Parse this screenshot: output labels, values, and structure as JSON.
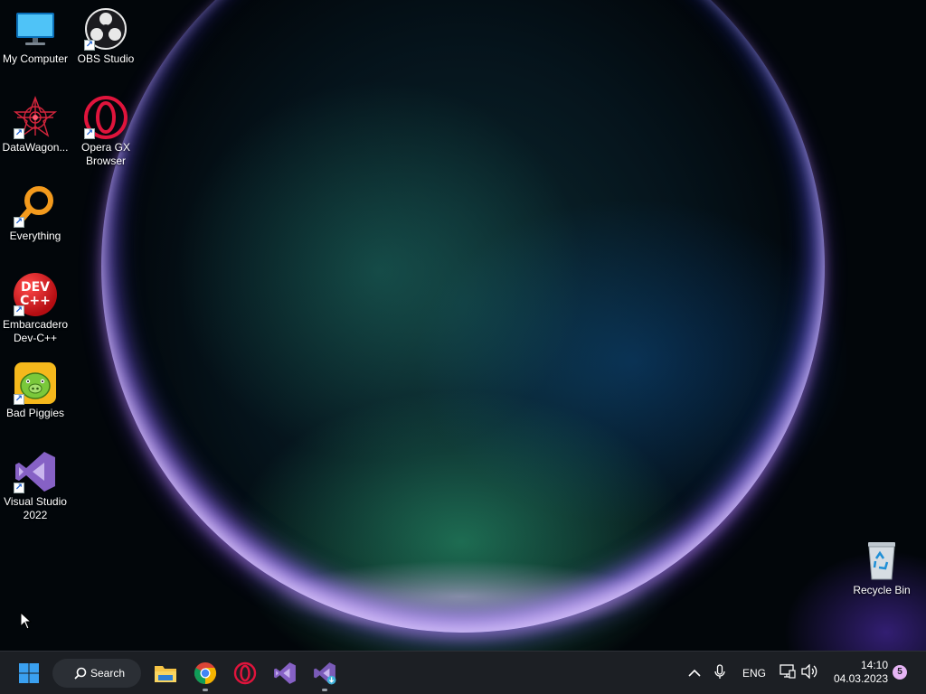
{
  "desktop_icons": [
    {
      "label": "My Computer",
      "icon": "monitor-icon",
      "shortcut": false
    },
    {
      "label": "OBS Studio",
      "icon": "obs-icon",
      "shortcut": true
    },
    {
      "label": "DataWagon...",
      "icon": "datawagon-icon",
      "shortcut": true
    },
    {
      "label": "Opera GX\nBrowser",
      "icon": "opera-gx-icon",
      "shortcut": true
    },
    {
      "label": "Everything",
      "icon": "everything-search-icon",
      "shortcut": true
    },
    {
      "label": "Embarcadero\nDev-C++",
      "icon": "dev-cpp-icon",
      "shortcut": true,
      "icon_text": "DEV\nC++"
    },
    {
      "label": "Bad Piggies",
      "icon": "bad-piggies-icon",
      "shortcut": true
    },
    {
      "label": "Visual Studio\n2022",
      "icon": "visual-studio-icon",
      "shortcut": true
    },
    {
      "label": "Recycle Bin",
      "icon": "recycle-bin-icon",
      "shortcut": false
    }
  ],
  "taskbar": {
    "start_icon": "windows-start-icon",
    "search_label": "Search",
    "pinned_apps": [
      {
        "name": "File Explorer",
        "icon": "file-explorer-icon",
        "running": false
      },
      {
        "name": "Google Chrome",
        "icon": "chrome-icon",
        "running": true
      },
      {
        "name": "Opera GX",
        "icon": "opera-gx-icon",
        "running": false
      },
      {
        "name": "Visual Studio 2022",
        "icon": "visual-studio-icon",
        "running": false
      },
      {
        "name": "Visual Studio Installer",
        "icon": "visual-studio-installer-icon",
        "running": true
      }
    ],
    "tray": {
      "language": "ENG",
      "time": "14:10",
      "date": "04.03.2023",
      "notification_count": "5"
    }
  },
  "colors": {
    "taskbar_bg": "#1c1f24",
    "windows_blue": "#3aa0f0",
    "opera_red": "#e0143c",
    "vs_purple": "#8661c5",
    "badge": "#e6b4f5"
  }
}
